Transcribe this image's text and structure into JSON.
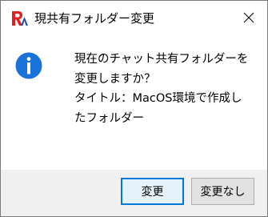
{
  "window": {
    "title": "現共有フォルダー変更"
  },
  "icons": {
    "app": "app-logo-icon",
    "close": "close-icon",
    "info": "info-icon"
  },
  "message": {
    "line1": "現在のチャット共有フォルダーを",
    "line2": "変更しますか？",
    "line3": "タイトル：MacOS環境で作成し",
    "line4": "たフォルダー"
  },
  "buttons": {
    "confirm_label": "変更",
    "cancel_label": "変更なし"
  },
  "colors": {
    "info_blue": "#1a73d9",
    "logo_red": "#e02020",
    "logo_blue": "#1f4fbf",
    "focus_border": "#0078d7",
    "footer_bg": "#f0f0f0"
  }
}
